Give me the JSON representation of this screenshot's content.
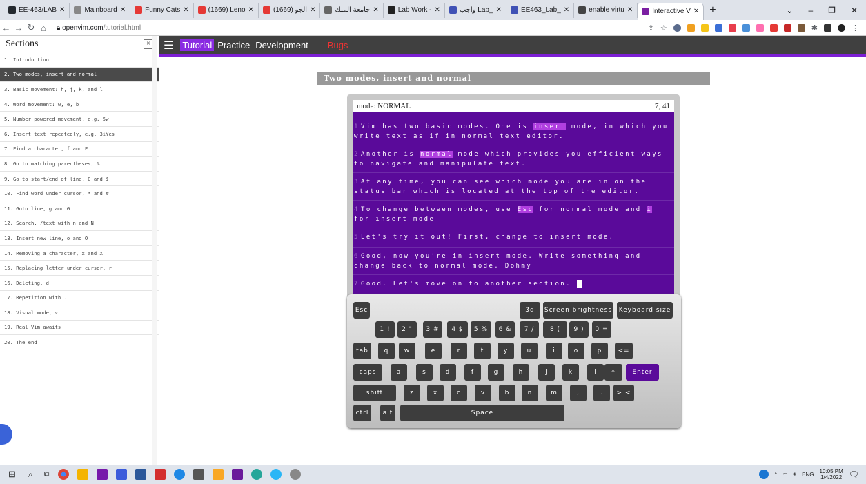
{
  "browser": {
    "tabs": [
      {
        "label": "EE-463/LAB",
        "color": "#24292e",
        "active": false
      },
      {
        "label": "Mainboard",
        "color": "#888888",
        "active": false
      },
      {
        "label": "Funny Cats",
        "color": "#e53935",
        "active": false
      },
      {
        "label": "(1669) Leno",
        "color": "#e53935",
        "active": false
      },
      {
        "label": "(1669) الجو",
        "color": "#e53935",
        "active": false
      },
      {
        "label": "جامعة الملك",
        "color": "#666666",
        "active": false
      },
      {
        "label": "Lab Work -",
        "color": "#222222",
        "active": false
      },
      {
        "label": "واجب Lab_",
        "color": "#3f51b5",
        "active": false
      },
      {
        "label": "EE463_Lab_",
        "color": "#3f51b5",
        "active": false
      },
      {
        "label": "enable virtu",
        "color": "#444444",
        "active": false
      },
      {
        "label": "Interactive V",
        "color": "#7b1fa2",
        "active": true
      }
    ],
    "new_tab": "+",
    "url_host": "openvim.com",
    "url_path": "/tutorial.html"
  },
  "sidebar": {
    "title": "Sections",
    "close": "×",
    "items": [
      {
        "label": "1. Introduction",
        "active": false
      },
      {
        "label": "2. Two modes, insert and normal",
        "active": true
      },
      {
        "label": "3. Basic movement: h, j, k, and l",
        "active": false
      },
      {
        "label": "4. Word movement: w, e, b",
        "active": false
      },
      {
        "label": "5. Number powered movement, e.g. 5w",
        "active": false
      },
      {
        "label": "6. Insert text repeatedly, e.g. 3iYes",
        "active": false
      },
      {
        "label": "7. Find a character, f and F",
        "active": false
      },
      {
        "label": "8. Go to matching parentheses, %",
        "active": false
      },
      {
        "label": "9. Go to start/end of line, 0 and $",
        "active": false
      },
      {
        "label": "10. Find word under cursor, * and #",
        "active": false
      },
      {
        "label": "11. Goto line, g and G",
        "active": false
      },
      {
        "label": "12. Search, /text with n and N",
        "active": false
      },
      {
        "label": "13. Insert new line, o and O",
        "active": false
      },
      {
        "label": "14. Removing a character, x and X",
        "active": false
      },
      {
        "label": "15. Replacing letter under cursor, r",
        "active": false
      },
      {
        "label": "16. Deleting, d",
        "active": false
      },
      {
        "label": "17. Repetition with .",
        "active": false
      },
      {
        "label": "18. Visual mode, v",
        "active": false
      },
      {
        "label": "19. Real Vim awaits",
        "active": false
      },
      {
        "label": "20. The end",
        "active": false
      }
    ]
  },
  "nav": {
    "tutorial": "Tutorial",
    "practice": "Practice",
    "development": "Development",
    "bugs": "Bugs"
  },
  "section_title": "Two modes, insert and normal",
  "editor": {
    "mode": "mode: NORMAL",
    "position": "7, 41",
    "lines": [
      {
        "n": "1",
        "parts": [
          {
            "t": "Vim has two basic modes. One is "
          },
          {
            "t": "insert",
            "hl": true
          },
          {
            "t": " mode, in which you write text as if in normal text editor."
          }
        ]
      },
      {
        "n": "2",
        "parts": [
          {
            "t": "Another is "
          },
          {
            "t": "normal",
            "hl": true
          },
          {
            "t": " mode which provides you efficient ways to navigate and manipulate text."
          }
        ]
      },
      {
        "n": "3",
        "parts": [
          {
            "t": "At any time, you can see which mode you are in on the status bar which is located at the top of the editor."
          }
        ]
      },
      {
        "n": "4",
        "parts": [
          {
            "t": "To change between modes, use "
          },
          {
            "t": "Esc",
            "hl": true
          },
          {
            "t": " for normal mode and "
          },
          {
            "t": "i",
            "hl": true
          },
          {
            "t": " for insert mode"
          }
        ]
      },
      {
        "n": "5",
        "parts": [
          {
            "t": "Let's try it out! First, change to insert mode."
          }
        ]
      },
      {
        "n": "6",
        "parts": [
          {
            "t": "Good, now you're in insert mode. Write something and change back to normal mode. Dohmy"
          }
        ]
      },
      {
        "n": "7",
        "parts": [
          {
            "t": "Good. Let's move on to another section. "
          }
        ],
        "cursor": true
      }
    ]
  },
  "keyboard": {
    "rows": [
      [
        "Esc",
        "3d",
        "Screen brightness",
        "Keyboard size"
      ],
      [
        "1 !",
        "2 \"",
        "3 #",
        "4 $",
        "5 %",
        "6 &",
        "7 /",
        "8 (",
        "9 )",
        "0 ="
      ],
      [
        "tab",
        "q",
        "w",
        "e",
        "r",
        "t",
        "y",
        "u",
        "i",
        "o",
        "p",
        "<="
      ],
      [
        "caps",
        "a",
        "s",
        "d",
        "f",
        "g",
        "h",
        "j",
        "k",
        "l",
        "*",
        "Enter"
      ],
      [
        "shift",
        "z",
        "x",
        "c",
        "v",
        "b",
        "n",
        "m",
        ",",
        ".",
        "> <"
      ],
      [
        "ctrl",
        "alt",
        "Space"
      ]
    ]
  },
  "taskbar": {
    "lang": "ENG",
    "time": "10:05 PM",
    "date": "1/4/2022"
  }
}
